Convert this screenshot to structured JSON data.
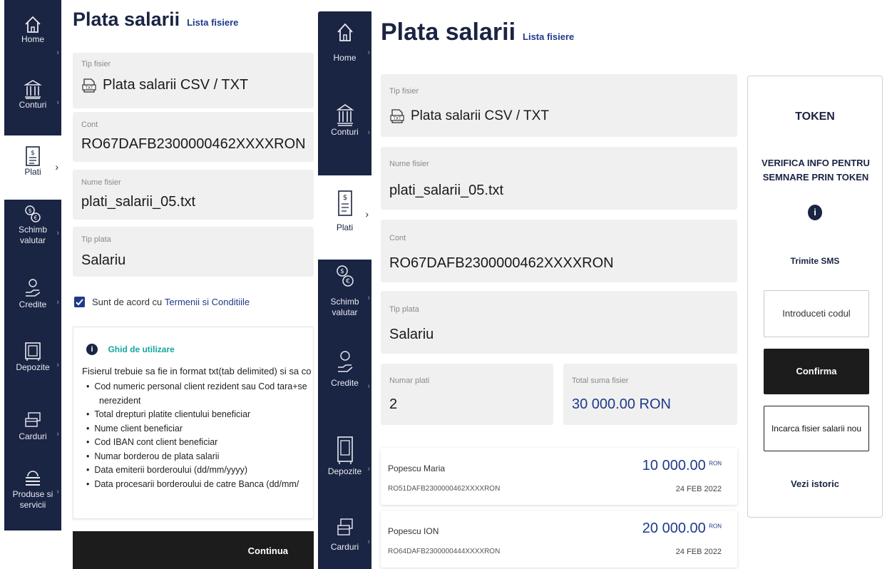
{
  "nav": {
    "home": "Home",
    "conturi": "Conturi",
    "plati": "Plati",
    "schimb": "Schimb\nvalutar",
    "credite": "Credite",
    "depozite": "Depozite",
    "carduri": "Carduri",
    "produse": "Produse si\nservicii"
  },
  "page": {
    "title": "Plata salarii",
    "list_link": "Lista fisiere"
  },
  "form_a": {
    "tip_fisier_label": "Tip fisier",
    "tip_fisier_value": "Plata salarii CSV / TXT",
    "cont_label": "Cont",
    "cont_value": "RO67DAFB2300000462XXXXRON",
    "nume_label": "Nume fisier",
    "nume_value": "plati_salarii_05.txt",
    "tip_plata_label": "Tip plata",
    "tip_plata_value": "Salariu",
    "terms_prefix": "Sunt de acord cu ",
    "terms_link": "Termenii si Conditiile",
    "guide_title": "Ghid de utilizare",
    "guide_intro": "Fisierul trebuie sa fie in format txt(tab delimited) si sa co",
    "guide_items": [
      "Cod numeric personal client rezident sau Cod tara+se",
      "nerezident",
      "Total drepturi platite clientului beneficiar",
      "Nume client beneficiar",
      "Cod IBAN cont client beneficiar",
      "Numar borderou de plata salarii",
      "Data emiterii borderoului (dd/mm/yyyy)",
      "Data procesarii borderoului de catre Banca (dd/mm/"
    ],
    "continue_label": "Continua"
  },
  "form_b": {
    "tip_fisier_label": "Tip fisier",
    "tip_fisier_value": "Plata salarii CSV / TXT",
    "nume_label": "Nume fisier",
    "nume_value": "plati_salarii_05.txt",
    "cont_label": "Cont",
    "cont_value": "RO67DAFB2300000462XXXXRON",
    "tip_plata_label": "Tip plata",
    "tip_plata_value": "Salariu",
    "numar_label": "Numar plati",
    "numar_value": "2",
    "total_label": "Total suma fisier",
    "total_value": "30 000.00 RON",
    "payments": [
      {
        "name": "Popescu Maria",
        "iban": "RO51DAFB2300000462XXXXRON",
        "amount": "10 000.00",
        "currency": "RON",
        "date": "24 FEB 2022"
      },
      {
        "name": "Popescu ION",
        "iban": "RO64DAFB2300000444XXXXRON",
        "amount": "20 000.00",
        "currency": "RON",
        "date": "24 FEB 2022"
      }
    ]
  },
  "token": {
    "title": "TOKEN",
    "info": "VERIFICA INFO PENTRU SEMNARE PRIN TOKEN",
    "sms": "Trimite SMS",
    "code_btn": "Introduceti codul",
    "confirm_btn": "Confirma",
    "upload_btn": "Incarca fisier salarii nou",
    "history": "Vezi istoric"
  },
  "colors": {
    "navy": "#1a2443",
    "field_bg": "#f0f0f0",
    "teal": "#13a7a0",
    "checkbox": "#1e3a8a"
  }
}
